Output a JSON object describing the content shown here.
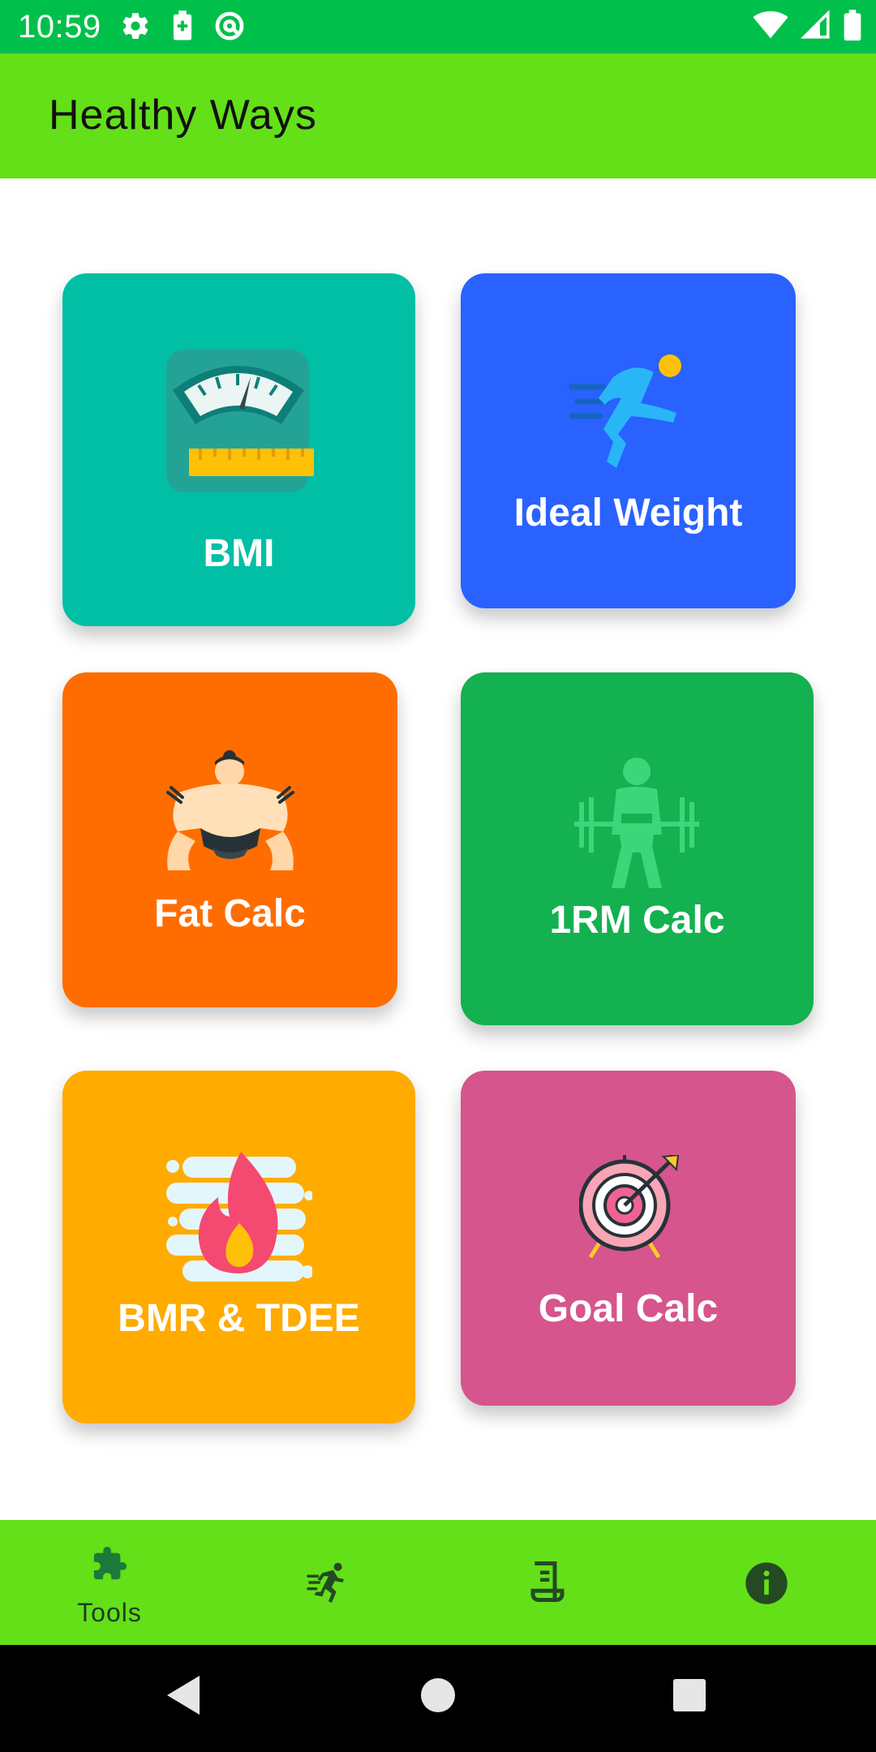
{
  "status_bar": {
    "time": "10:59",
    "left_icons": [
      "gear-icon",
      "battery-saver-icon",
      "at-sign-icon"
    ],
    "right_icons": [
      "wifi-icon",
      "signal-icon",
      "battery-icon"
    ],
    "color": "#00c04b"
  },
  "app_bar": {
    "title": "Healthy Ways",
    "color": "#64e019"
  },
  "tools": [
    {
      "label": "BMI",
      "icon": "scale-icon",
      "color": "#00bfa5"
    },
    {
      "label": "Ideal Weight",
      "icon": "runner-icon",
      "color": "#2962ff"
    },
    {
      "label": "Fat Calc",
      "icon": "sumo-wrestler-icon",
      "color": "#ff6d00"
    },
    {
      "label": "1RM Calc",
      "icon": "weightlifter-icon",
      "color": "#14b150"
    },
    {
      "label": "BMR & TDEE",
      "icon": "flame-icon",
      "color": "#ffab00"
    },
    {
      "label": "Goal Calc",
      "icon": "target-icon",
      "color": "#d5558c"
    }
  ],
  "bottom_nav": {
    "items": [
      {
        "label": "Tools",
        "icon": "puzzle-icon",
        "active": true
      },
      {
        "label": "",
        "icon": "running-icon",
        "active": false
      },
      {
        "label": "",
        "icon": "receipt-icon",
        "active": false
      },
      {
        "label": "",
        "icon": "info-icon",
        "active": false
      }
    ],
    "color": "#64e019"
  },
  "system_nav": {
    "buttons": [
      "back-icon",
      "home-icon",
      "recents-icon"
    ]
  }
}
